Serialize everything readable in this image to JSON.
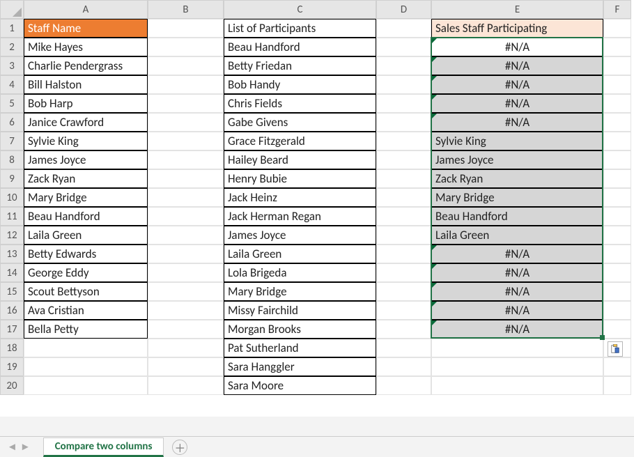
{
  "columns": [
    "A",
    "B",
    "C",
    "D",
    "E",
    "F"
  ],
  "rows": [
    "1",
    "2",
    "3",
    "4",
    "5",
    "6",
    "7",
    "8",
    "9",
    "10",
    "11",
    "12",
    "13",
    "14",
    "15",
    "16",
    "17",
    "18",
    "19",
    "20"
  ],
  "headerA": "Staff Name",
  "headerC": "List of Participants",
  "headerE": "Sales Staff Participating",
  "colA": [
    "Mike Hayes",
    "Charlie Pendergrass",
    "Bill Halston",
    "Bob Harp",
    "Janice Crawford",
    "Sylvie King",
    "James Joyce",
    "Zack Ryan",
    "Mary Bridge",
    "Beau Handford",
    "Laila Green",
    "Betty Edwards",
    "George Eddy",
    "Scout Bettyson",
    "Ava Cristian",
    "Bella Petty"
  ],
  "colC": [
    "Beau Handford",
    "Betty Friedan",
    "Bob Handy",
    "Chris Fields",
    "Gabe Givens",
    "Grace Fitzgerald",
    "Hailey Beard",
    "Henry Bubie",
    "Jack Heinz",
    "Jack Herman Regan",
    "James Joyce",
    "Laila Green",
    "Lola Brigeda",
    "Mary Bridge",
    "Missy Fairchild",
    "Morgan Brooks",
    "Pat Sutherland",
    "Sara Hanggler",
    "Sara Moore"
  ],
  "colE": [
    {
      "v": "#N/A",
      "err": true,
      "center": true
    },
    {
      "v": "#N/A",
      "err": true,
      "center": true
    },
    {
      "v": "#N/A",
      "err": true,
      "center": true
    },
    {
      "v": "#N/A",
      "err": true,
      "center": true
    },
    {
      "v": "#N/A",
      "err": true,
      "center": true
    },
    {
      "v": "Sylvie King",
      "err": false,
      "center": false
    },
    {
      "v": "James Joyce",
      "err": false,
      "center": false
    },
    {
      "v": "Zack Ryan",
      "err": false,
      "center": false
    },
    {
      "v": "Mary Bridge",
      "err": false,
      "center": false
    },
    {
      "v": "Beau Handford",
      "err": false,
      "center": false
    },
    {
      "v": "Laila Green",
      "err": false,
      "center": false
    },
    {
      "v": "#N/A",
      "err": true,
      "center": true
    },
    {
      "v": "#N/A",
      "err": true,
      "center": true
    },
    {
      "v": "#N/A",
      "err": true,
      "center": true
    },
    {
      "v": "#N/A",
      "err": true,
      "center": true
    },
    {
      "v": "#N/A",
      "err": true,
      "center": true
    }
  ],
  "sheetTab": "Compare two columns",
  "chart_data": {
    "type": "table",
    "title": "Staff comparison",
    "columns": [
      "Staff Name",
      "List of Participants",
      "Sales Staff Participating"
    ],
    "data": {
      "Staff Name": [
        "Mike Hayes",
        "Charlie Pendergrass",
        "Bill Halston",
        "Bob Harp",
        "Janice Crawford",
        "Sylvie King",
        "James Joyce",
        "Zack Ryan",
        "Mary Bridge",
        "Beau Handford",
        "Laila Green",
        "Betty Edwards",
        "George Eddy",
        "Scout Bettyson",
        "Ava Cristian",
        "Bella Petty"
      ],
      "List of Participants": [
        "Beau Handford",
        "Betty Friedan",
        "Bob Handy",
        "Chris Fields",
        "Gabe Givens",
        "Grace Fitzgerald",
        "Hailey Beard",
        "Henry Bubie",
        "Jack Heinz",
        "Jack Herman Regan",
        "James Joyce",
        "Laila Green",
        "Lola Brigeda",
        "Mary Bridge",
        "Missy Fairchild",
        "Morgan Brooks",
        "Pat Sutherland",
        "Sara Hanggler",
        "Sara Moore"
      ],
      "Sales Staff Participating": [
        "#N/A",
        "#N/A",
        "#N/A",
        "#N/A",
        "#N/A",
        "Sylvie King",
        "James Joyce",
        "Zack Ryan",
        "Mary Bridge",
        "Beau Handford",
        "Laila Green",
        "#N/A",
        "#N/A",
        "#N/A",
        "#N/A",
        "#N/A"
      ]
    }
  }
}
